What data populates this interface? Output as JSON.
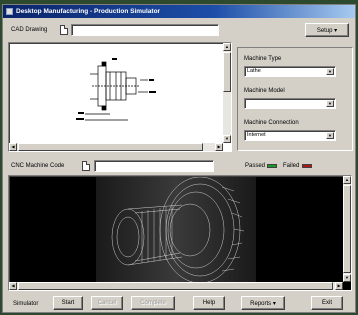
{
  "window": {
    "title": "Desktop Manufacturing - Production Simulator"
  },
  "top_bar": {
    "cad_label": "CAD Drawing",
    "setup_label": "Setup ▾"
  },
  "machine_panel": {
    "type_label": "Machine Type",
    "type_value": "Lathe",
    "model_label": "Machine Model",
    "model_value": "",
    "connection_label": "Machine Connection",
    "connection_value": "Internet"
  },
  "cnc_bar": {
    "label": "CNC Machine Code",
    "passed_label": "Passed",
    "failed_label": "Failed",
    "passed_color": "#1a9a2a",
    "failed_color": "#b01818"
  },
  "bottom_bar": {
    "simulator_label": "Simulator",
    "start_label": "Start",
    "cancel_label": "Cancel",
    "complete_label": "Complete",
    "help_label": "Help",
    "reports_label": "Reports ▾",
    "exit_label": "Exit"
  },
  "icons": {
    "app": "app-icon",
    "cad_doc": "document-icon",
    "cnc_doc": "document-icon",
    "dropdown": "chevron-down-icon"
  }
}
